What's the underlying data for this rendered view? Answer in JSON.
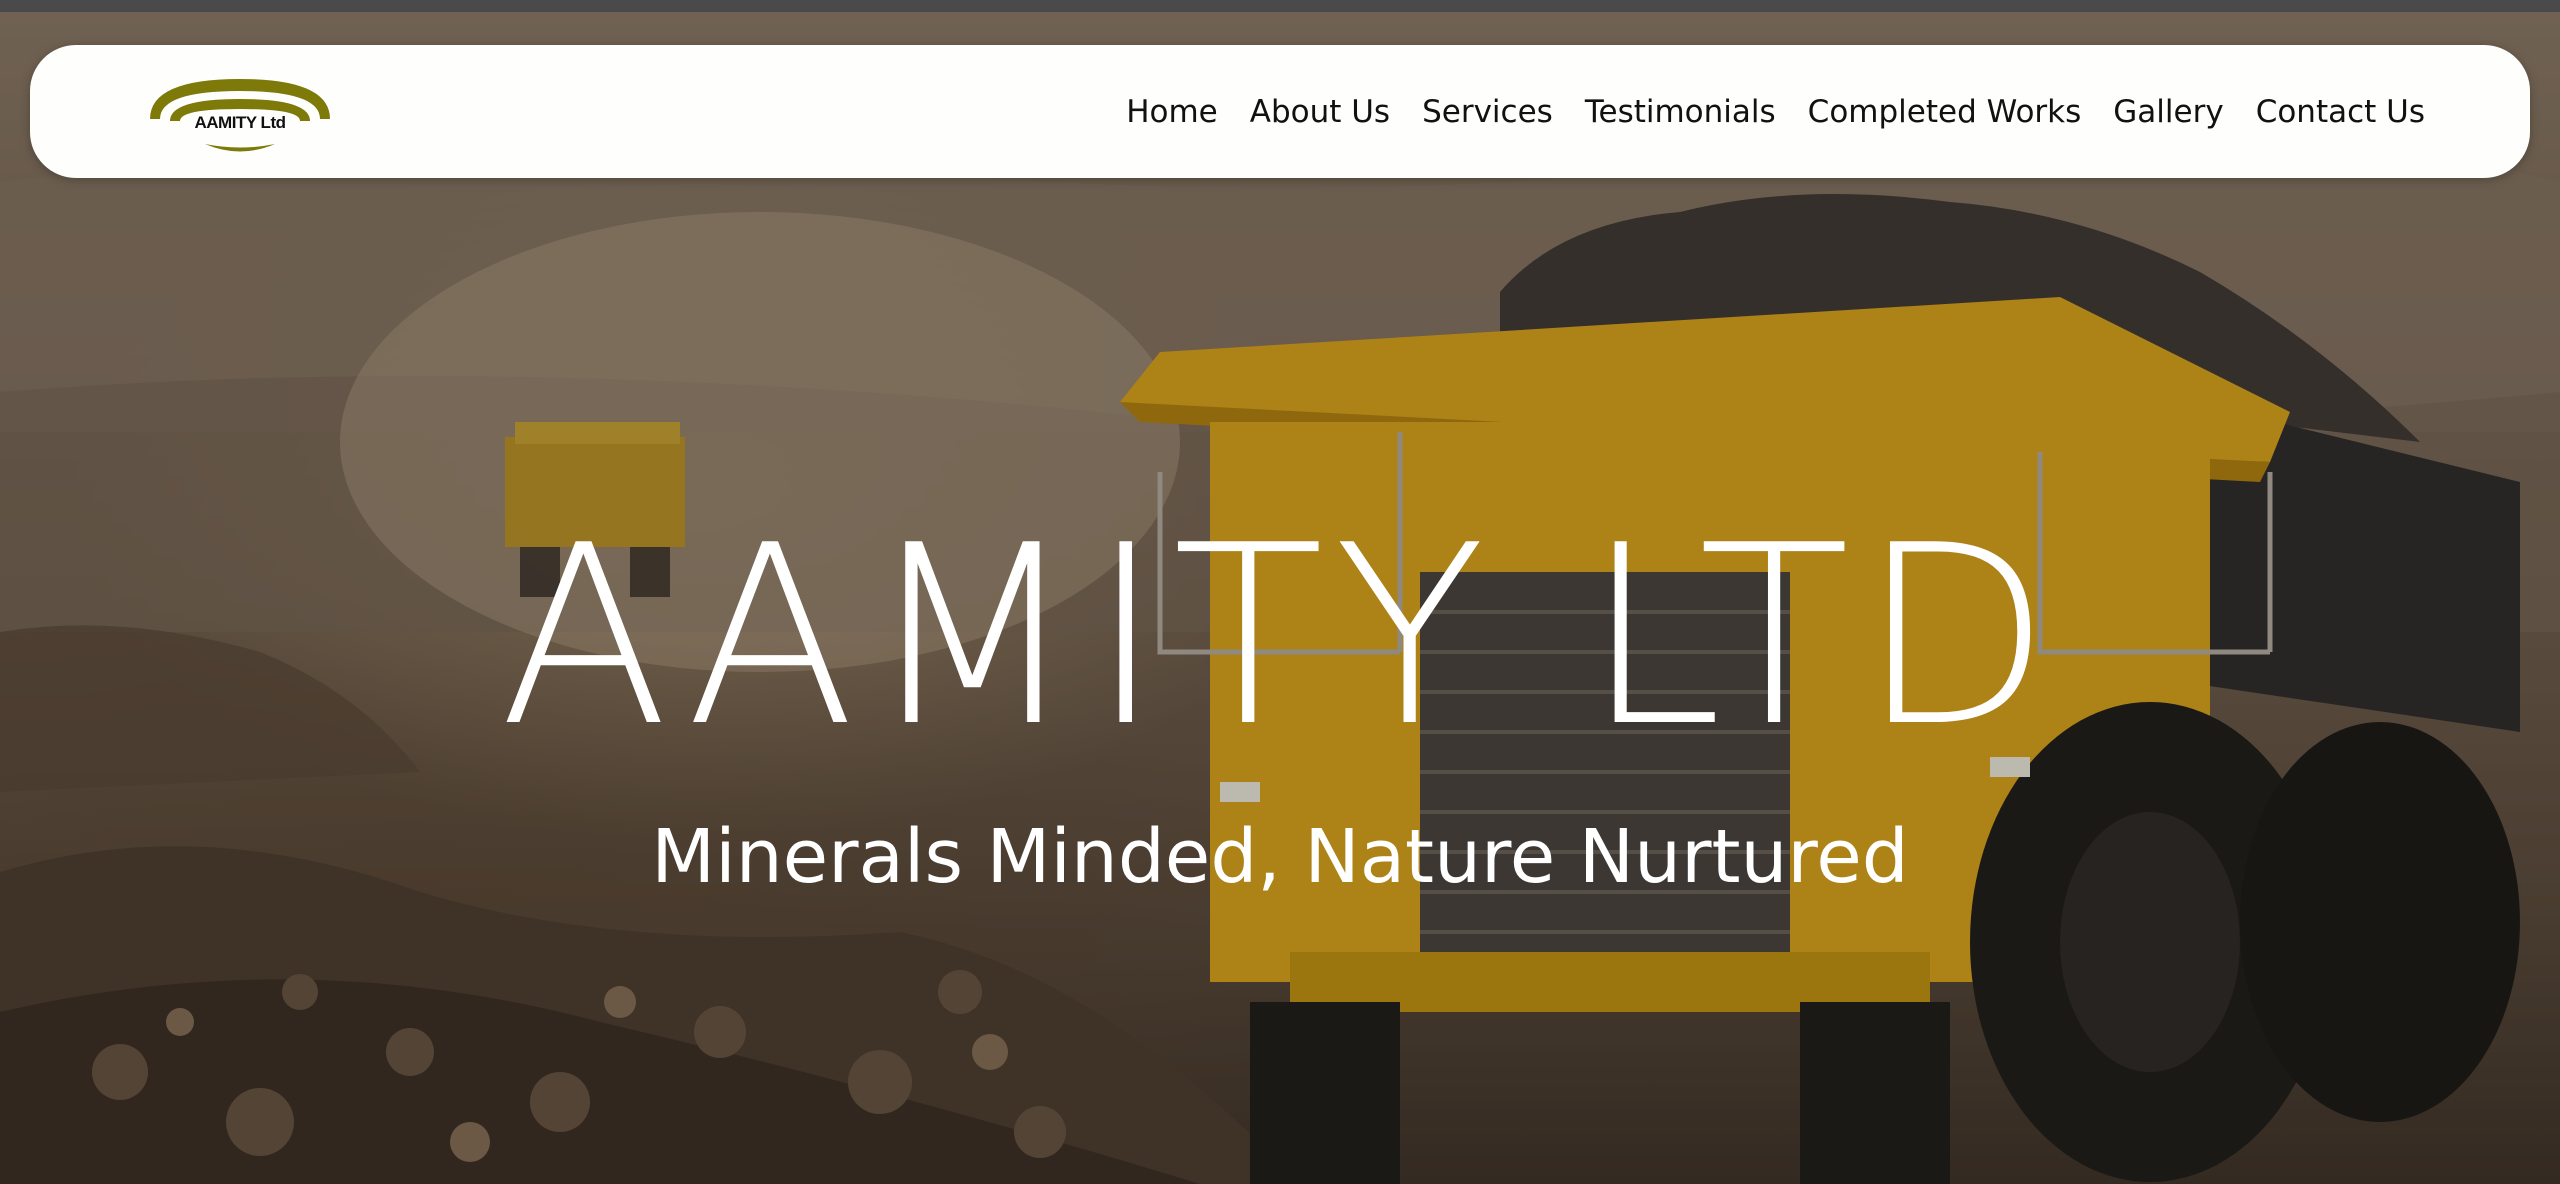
{
  "brand": {
    "logo_text": "AAMITY Ltd",
    "logo_color": "#7d7a0a"
  },
  "nav": {
    "items": [
      {
        "label": "Home"
      },
      {
        "label": "About Us"
      },
      {
        "label": "Services"
      },
      {
        "label": "Testimonials"
      },
      {
        "label": "Completed Works"
      },
      {
        "label": "Gallery"
      },
      {
        "label": "Contact Us"
      }
    ]
  },
  "hero": {
    "title": "AAMITY LTD",
    "tagline": "Minerals Minded, Nature Nurtured",
    "text_color": "#ffffff",
    "accent_truck_color": "#e0a91a"
  }
}
